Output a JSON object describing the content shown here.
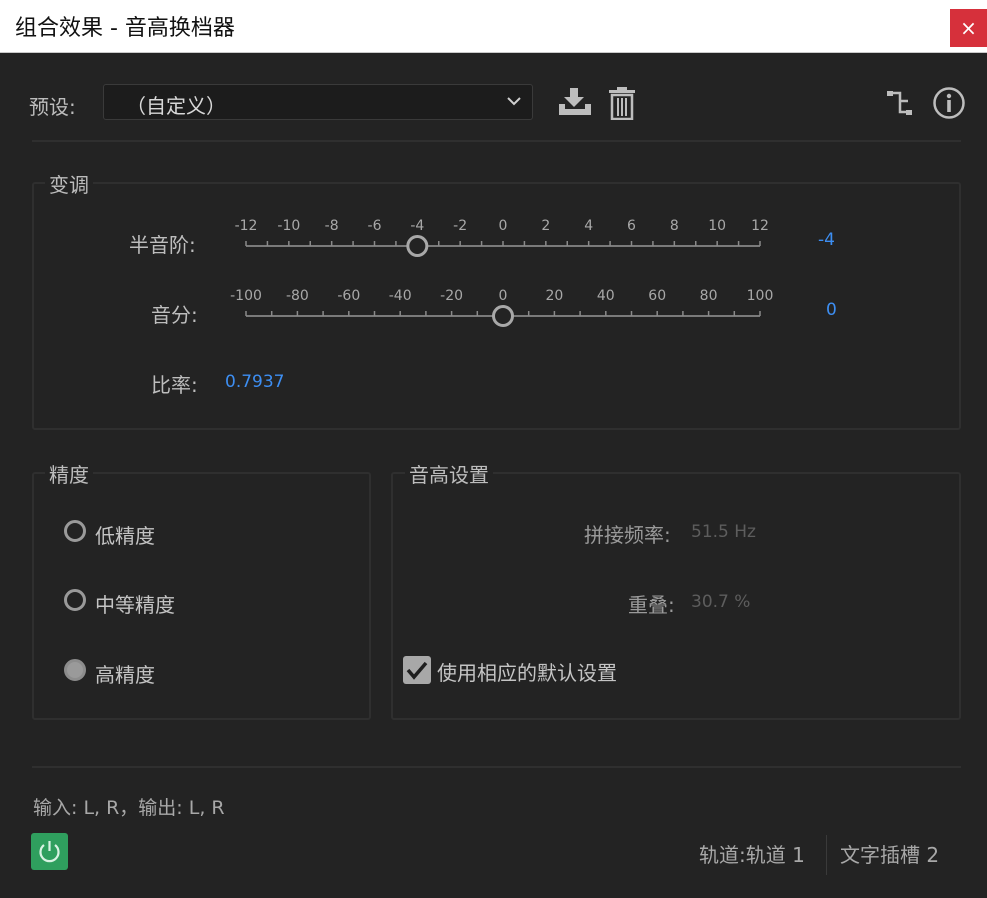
{
  "window": {
    "title": "组合效果 - 音高换档器",
    "close_glyph": "×"
  },
  "toolbar": {
    "preset_label": "预设:",
    "preset_value": "（自定义）",
    "icons": [
      "download-preset-icon",
      "trash-icon",
      "routing-icon",
      "info-icon"
    ]
  },
  "transpose": {
    "legend": "变调",
    "semitone": {
      "label": "半音阶:",
      "value": -4,
      "value_text": "-4",
      "ticks": [
        "-12",
        "-10",
        "-8",
        "-6",
        "-4",
        "-2",
        "0",
        "2",
        "4",
        "6",
        "8",
        "10",
        "12"
      ],
      "min": -12,
      "max": 12
    },
    "cents": {
      "label": "音分:",
      "value": 0,
      "value_text": "0",
      "ticks": [
        "-100",
        "-80",
        "-60",
        "-40",
        "-20",
        "0",
        "20",
        "40",
        "60",
        "80",
        "100"
      ],
      "min": -100,
      "max": 100
    },
    "ratio_label": "比率:",
    "ratio_value": "0.7937"
  },
  "precision": {
    "legend": "精度",
    "options": [
      {
        "label": "低精度",
        "selected": false
      },
      {
        "label": "中等精度",
        "selected": false
      },
      {
        "label": "高精度",
        "selected": true
      }
    ]
  },
  "pitch_settings": {
    "legend": "音高设置",
    "splice_label": "拼接频率:",
    "splice_value": "51.5 Hz",
    "overlap_label": "重叠:",
    "overlap_value": "30.7 %",
    "use_default_label": "使用相应的默认设置",
    "use_default_checked": true
  },
  "footer": {
    "io_text": "输入: L, R，输出: L, R",
    "track_text": "轨道:轨道 1",
    "slot_text": "文字插槽 2"
  },
  "colors": {
    "accent_blue": "#3d8ef2",
    "power_green": "#2f9f5e",
    "close_red": "#d6303b"
  }
}
